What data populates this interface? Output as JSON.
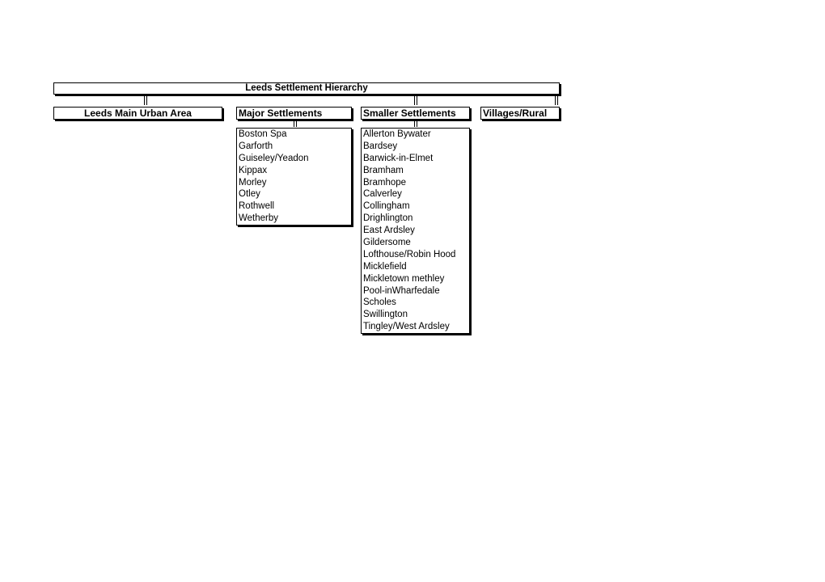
{
  "diagram": {
    "title": "Leeds Settlement Hierarchy",
    "categories": [
      {
        "label": "Leeds Main Urban Area",
        "items": []
      },
      {
        "label": "Major Settlements",
        "items": [
          "Boston Spa",
          "Garforth",
          "Guiseley/Yeadon",
          "Kippax",
          "Morley",
          "Otley",
          "Rothwell",
          "Wetherby"
        ]
      },
      {
        "label": "Smaller Settlements",
        "items": [
          "Allerton Bywater",
          "Bardsey",
          "Barwick-in-Elmet",
          "Bramham",
          "Bramhope",
          "Calverley",
          "Collingham",
          "Drighlington",
          "East Ardsley",
          "Gildersome",
          "Lofthouse/Robin Hood",
          "Micklefield",
          "Mickletown methley",
          "Pool-inWharfedale",
          "Scholes",
          "Swillington",
          "Tingley/West Ardsley"
        ]
      },
      {
        "label": "Villages/Rural",
        "items": []
      }
    ]
  }
}
